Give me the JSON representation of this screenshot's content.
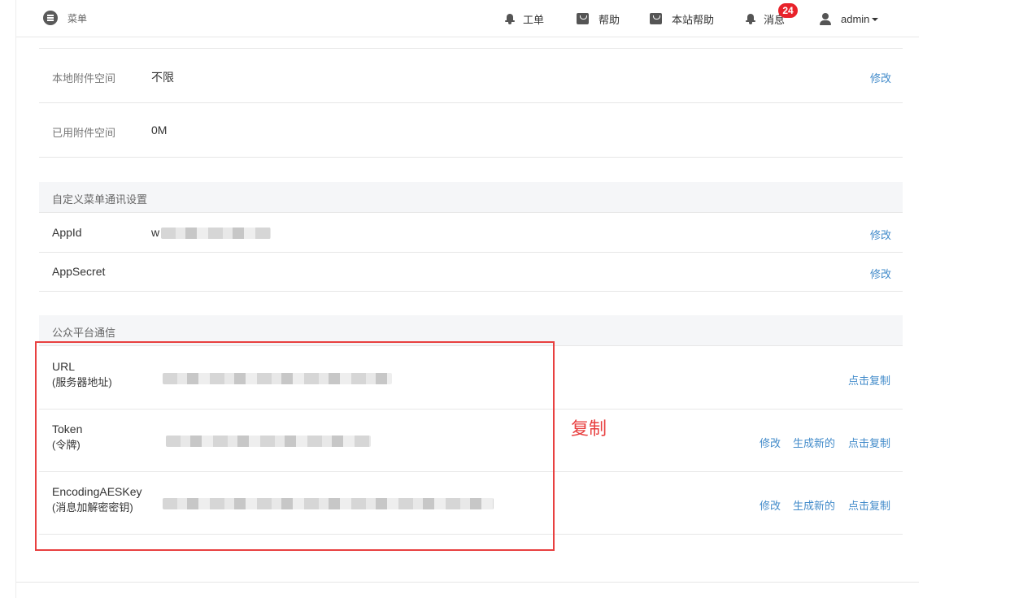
{
  "header": {
    "menu_label": "菜单",
    "nav": [
      {
        "label": "工单",
        "icon": "bell-icon"
      },
      {
        "label": "帮助",
        "icon": "shopping-bag-icon"
      },
      {
        "label": "本站帮助",
        "icon": "shopping-bag-icon"
      },
      {
        "label": "消息",
        "icon": "bell-icon",
        "badge": "24"
      }
    ],
    "user": "admin"
  },
  "attachments": [
    {
      "label": "本地附件空间",
      "value": "不限",
      "action": "修改"
    },
    {
      "label": "已用附件空间",
      "value": "0M"
    }
  ],
  "menu_comm": {
    "title": "自定义菜单通讯设置",
    "rows": [
      {
        "label": "AppId",
        "value": "w",
        "action": "修改"
      },
      {
        "label": "AppSecret",
        "action": "修改"
      }
    ]
  },
  "platform": {
    "title": "公众平台通信",
    "rows": [
      {
        "label": "URL",
        "sub": "(服务器地址)",
        "actions": [
          "点击复制"
        ]
      },
      {
        "label": "Token",
        "sub": "(令牌)",
        "actions": [
          "修改",
          "生成新的",
          "点击复制"
        ]
      },
      {
        "label": "EncodingAESKey",
        "sub": "(消息加解密密钥)",
        "actions": [
          "修改",
          "生成新的",
          "点击复制"
        ]
      }
    ]
  },
  "annotation": "复制",
  "colors": {
    "link": "#428bca",
    "badge": "#e8222a",
    "annotation": "#e84040",
    "section_bg": "#f5f6f8"
  }
}
